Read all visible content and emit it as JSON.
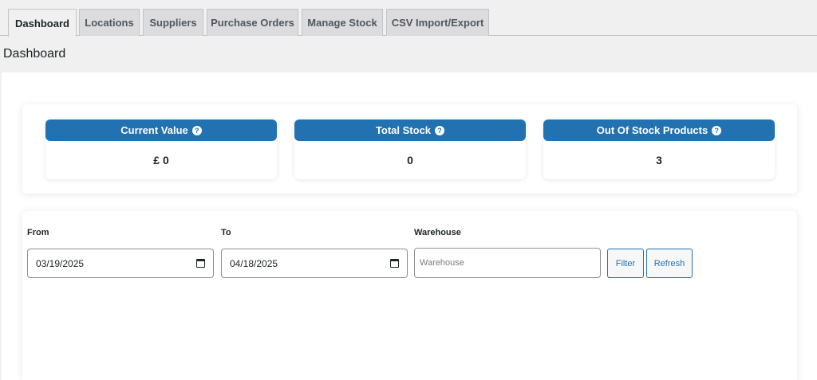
{
  "tabs": [
    {
      "label": "Dashboard",
      "active": true
    },
    {
      "label": "Locations"
    },
    {
      "label": "Suppliers"
    },
    {
      "label": "Purchase Orders"
    },
    {
      "label": "Manage Stock"
    },
    {
      "label": "CSV Import/Export"
    }
  ],
  "page": {
    "title": "Dashboard"
  },
  "stats": [
    {
      "title": "Current Value",
      "help_icon": "question-circle-icon",
      "value": "£ 0"
    },
    {
      "title": "Total Stock",
      "help_icon": "question-circle-icon",
      "value": "0"
    },
    {
      "title": "Out Of Stock Products",
      "help_icon": "question-circle-icon",
      "value": "3"
    }
  ],
  "filters": {
    "from_label": "From",
    "from_value": "03/19/2025",
    "to_label": "To",
    "to_value": "04/18/2025",
    "warehouse_label": "Warehouse",
    "warehouse_placeholder": "Warehouse",
    "filter_button": "Filter",
    "refresh_button": "Refresh",
    "calendar_icon": "calendar-icon"
  },
  "colors": {
    "accent": "#2271b1",
    "background": "#f0f0f1",
    "panel": "#ffffff"
  }
}
